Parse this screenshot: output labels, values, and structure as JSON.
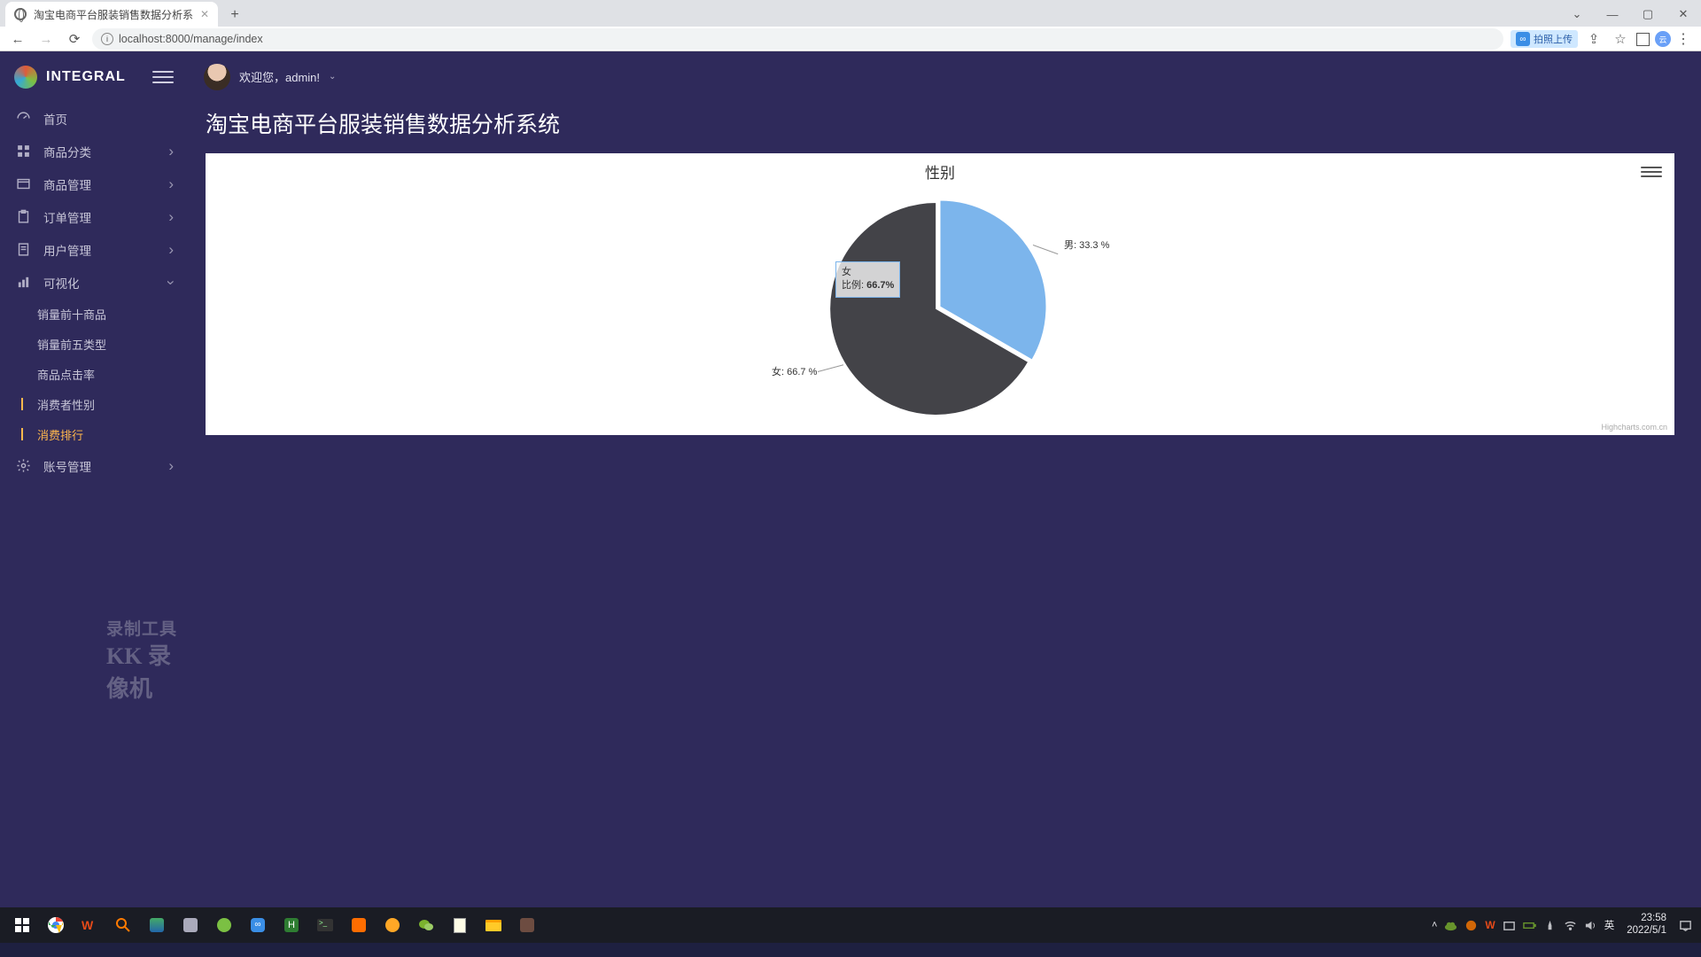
{
  "browser": {
    "tab_title": "淘宝电商平台服装销售数据分析系",
    "url": "localhost:8000/manage/index",
    "extension_label": "拍照上传"
  },
  "header": {
    "brand": "INTEGRAL",
    "welcome": "欢迎您，admin!"
  },
  "sidebar": {
    "items": [
      {
        "label": "首页"
      },
      {
        "label": "商品分类"
      },
      {
        "label": "商品管理"
      },
      {
        "label": "订单管理"
      },
      {
        "label": "用户管理"
      },
      {
        "label": "可视化"
      },
      {
        "label": "账号管理"
      }
    ],
    "viz_children": [
      {
        "label": "销量前十商品"
      },
      {
        "label": "销量前五类型"
      },
      {
        "label": "商品点击率"
      },
      {
        "label": "消费者性别"
      },
      {
        "label": "消费排行"
      }
    ]
  },
  "page_title": "淘宝电商平台服装销售数据分析系统",
  "chart_data": {
    "type": "pie",
    "title": "性别",
    "series": [
      {
        "name": "男",
        "value": 33.3,
        "color": "#7cb5ec",
        "label": "男: 33.3 %"
      },
      {
        "name": "女",
        "value": 66.7,
        "color": "#434348",
        "label": "女: 66.7 %"
      }
    ],
    "tooltip": {
      "name": "女",
      "ratio_label": "比例:",
      "ratio_value": "66.7%"
    },
    "credits": "Highcharts.com.cn"
  },
  "watermark": {
    "line1": "录制工具",
    "line2": "KK 录像机"
  },
  "taskbar": {
    "ime": "英",
    "time": "23:58",
    "date": "2022/5/1"
  }
}
